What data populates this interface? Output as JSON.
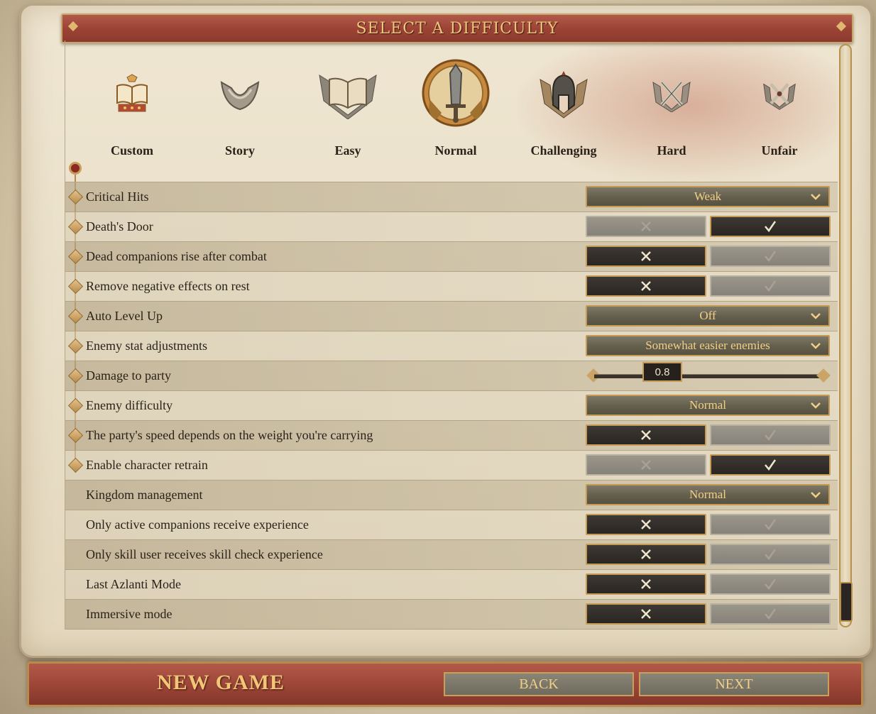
{
  "header": {
    "title": "SELECT A DIFFICULTY"
  },
  "difficulties": [
    {
      "label": "Custom",
      "icon": "custom-book-icon",
      "selected": false
    },
    {
      "label": "Story",
      "icon": "story-chevron-icon",
      "selected": false
    },
    {
      "label": "Easy",
      "icon": "easy-book-icon",
      "selected": false
    },
    {
      "label": "Normal",
      "icon": "normal-sword-emblem-icon",
      "selected": true
    },
    {
      "label": "Challenging",
      "icon": "challenging-helmet-icon",
      "selected": false
    },
    {
      "label": "Hard",
      "icon": "hard-crossed-swords-icon",
      "selected": false
    },
    {
      "label": "Unfair",
      "icon": "unfair-crossed-swords-icon",
      "selected": false
    }
  ],
  "settings": [
    {
      "label": "Critical Hits",
      "type": "dropdown",
      "value": "Weak"
    },
    {
      "label": "Death's Door",
      "type": "toggle",
      "value": true
    },
    {
      "label": "Dead companions rise after combat",
      "type": "toggle",
      "value": false
    },
    {
      "label": "Remove negative effects on rest",
      "type": "toggle",
      "value": false
    },
    {
      "label": "Auto Level Up",
      "type": "dropdown",
      "value": "Off"
    },
    {
      "label": "Enemy stat adjustments",
      "type": "dropdown",
      "value": "Somewhat easier enemies"
    },
    {
      "label": "Damage to party",
      "type": "slider",
      "value": "0.8"
    },
    {
      "label": "Enemy difficulty",
      "type": "dropdown",
      "value": "Normal"
    },
    {
      "label": "The party's speed depends on the weight you're carrying",
      "type": "toggle",
      "value": false
    },
    {
      "label": "Enable character retrain",
      "type": "toggle",
      "value": true
    },
    {
      "label": "Kingdom management",
      "type": "dropdown",
      "value": "Normal"
    },
    {
      "label": "Only active companions receive experience",
      "type": "toggle",
      "value": false
    },
    {
      "label": "Only skill user receives skill check experience",
      "type": "toggle",
      "value": false
    },
    {
      "label": "Last Azlanti Mode",
      "type": "toggle",
      "value": false
    },
    {
      "label": "Immersive mode",
      "type": "toggle",
      "value": false
    }
  ],
  "footer": {
    "title": "NEW GAME",
    "back_label": "BACK",
    "next_label": "NEXT"
  },
  "colors": {
    "accent_gold": "#c49a56",
    "banner_red": "#9c4436",
    "text_gold": "#f2cf88"
  }
}
